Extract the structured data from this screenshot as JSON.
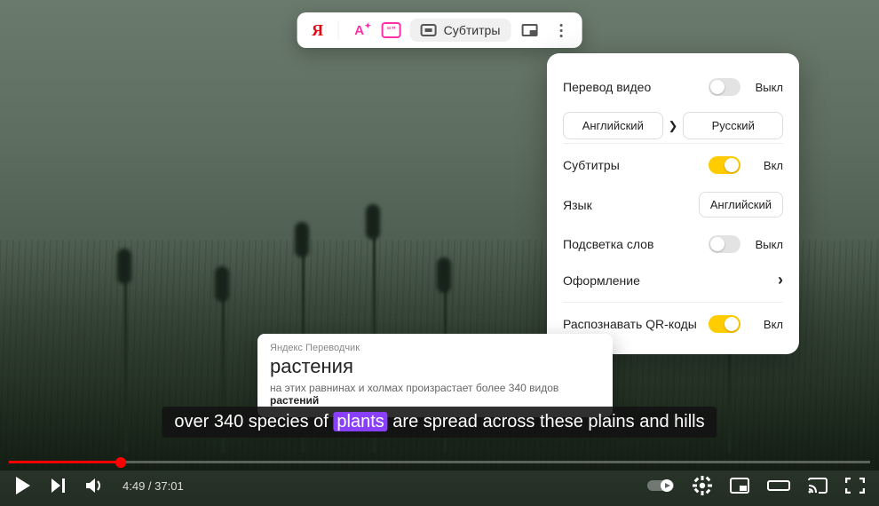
{
  "toolbar": {
    "subtitles_label": "Субтитры"
  },
  "panel": {
    "video_translation": {
      "label": "Перевод видео",
      "state": "Выкл",
      "on": false
    },
    "lang_from": "Английский",
    "lang_to": "Русский",
    "subtitles": {
      "label": "Субтитры",
      "state": "Вкл",
      "on": true
    },
    "language": {
      "label": "Язык",
      "value": "Английский"
    },
    "word_highlight": {
      "label": "Подсветка слов",
      "state": "Выкл",
      "on": false
    },
    "appearance": {
      "label": "Оформление"
    },
    "qr": {
      "label": "Распознавать QR-коды",
      "state": "Вкл",
      "on": true
    }
  },
  "popup": {
    "brand": "Яндекс Переводчик",
    "word": "растения",
    "sentence_pre": "на этих равнинах и холмах произрастает более 340 видов ",
    "sentence_bold": "растений"
  },
  "subtitle": {
    "pre": "over 340 species of ",
    "highlight": "plants",
    "post": " are spread across these plains and hills"
  },
  "player": {
    "current": "4:49",
    "duration": "37:01"
  }
}
